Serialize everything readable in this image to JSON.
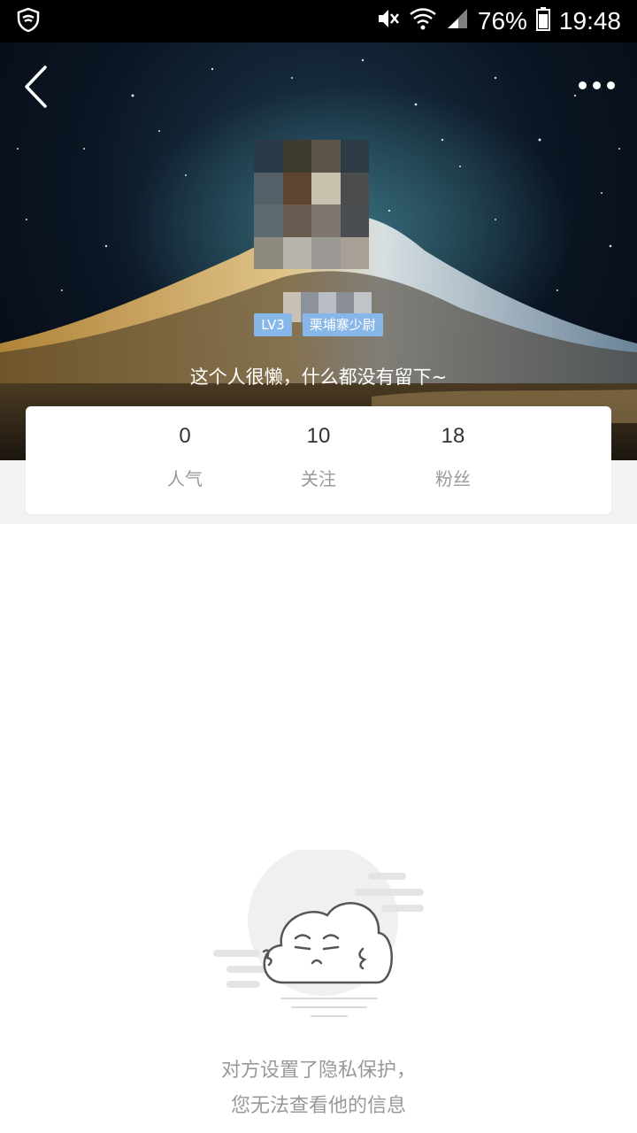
{
  "status_bar": {
    "battery_percent": "76%",
    "time": "19:48"
  },
  "header": {
    "back_icon": "chevron-left-icon",
    "more_icon": "more-horizontal-icon"
  },
  "profile": {
    "level_badge": "LV3",
    "rank_badge": "栗埔寨少尉",
    "bio": "这个人很懒，什么都没有留下~"
  },
  "stats": [
    {
      "value": "0",
      "label": "人气"
    },
    {
      "value": "10",
      "label": "关注"
    },
    {
      "value": "18",
      "label": "粉丝"
    }
  ],
  "privacy": {
    "line1": "对方设置了隐私保护，",
    "line2": "您无法查看他的信息"
  }
}
